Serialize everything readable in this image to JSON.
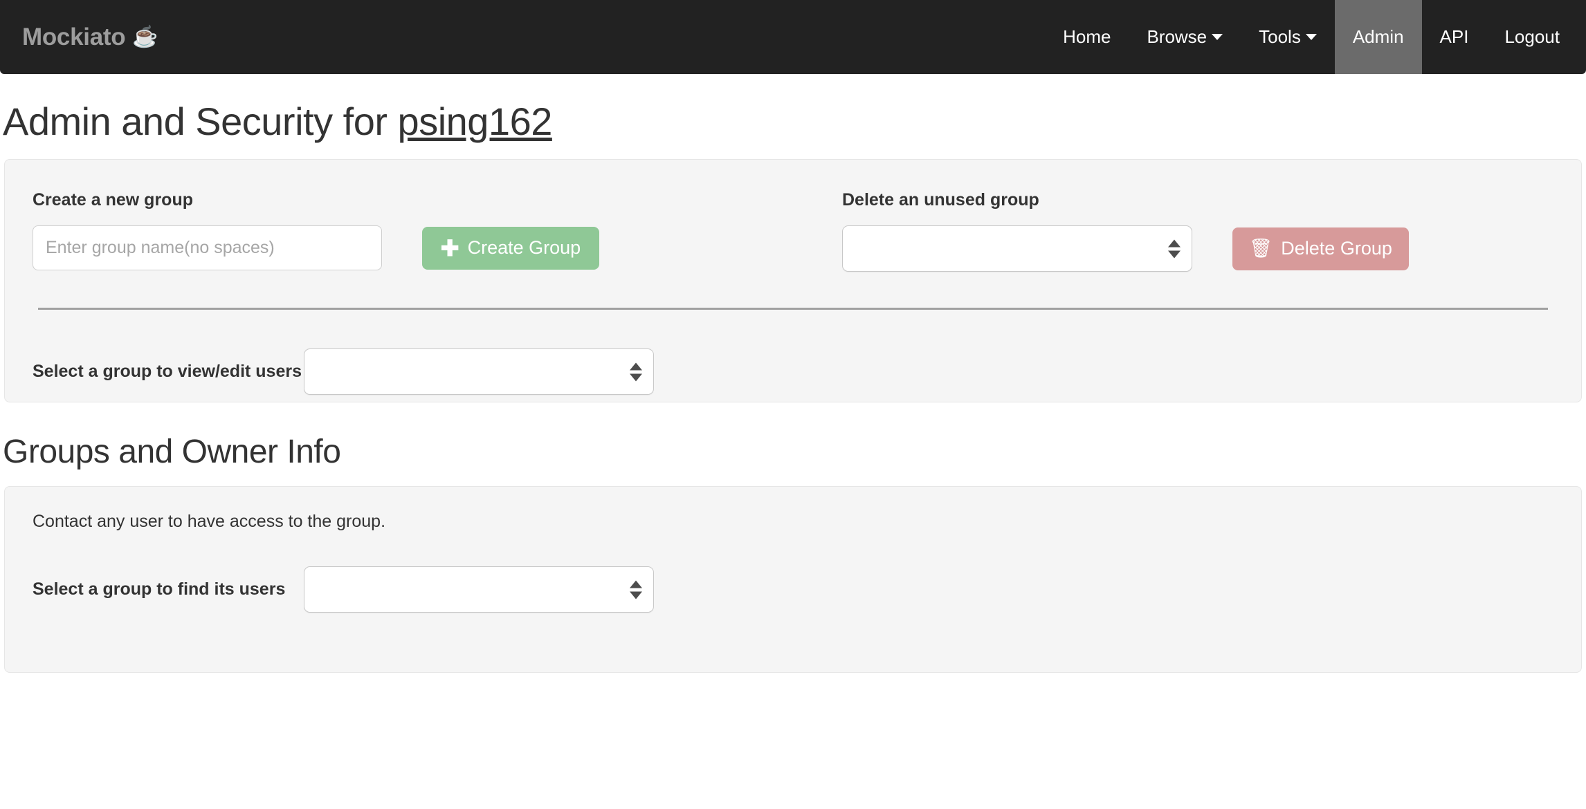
{
  "navbar": {
    "brand": "Mockiato",
    "brand_emoji": "☕",
    "links": [
      {
        "label": "Home",
        "has_caret": false,
        "active": false
      },
      {
        "label": "Browse",
        "has_caret": true,
        "active": false
      },
      {
        "label": "Tools",
        "has_caret": true,
        "active": false
      },
      {
        "label": "Admin",
        "has_caret": false,
        "active": true
      },
      {
        "label": "API",
        "has_caret": false,
        "active": false
      },
      {
        "label": "Logout",
        "has_caret": false,
        "active": false
      }
    ],
    "active_bg": "#6b6b6b",
    "bg": "#222222"
  },
  "page": {
    "title_prefix": "Admin and Security for ",
    "title_user": "psing162"
  },
  "admin_panel": {
    "create_heading": "Create a new group",
    "create_input_placeholder": "Enter group name(no spaces)",
    "create_input_value": "",
    "create_button_label": "Create Group",
    "create_button_color": "#8fc896",
    "delete_heading": "Delete an unused group",
    "delete_select_value": "",
    "delete_button_label": "Delete Group",
    "delete_button_color": "#d79a9a",
    "view_edit_label": "Select a group to view/edit users",
    "view_edit_select_value": ""
  },
  "groups_section": {
    "heading": "Groups and Owner Info",
    "note": "Contact any user to have access to the group.",
    "find_users_label": "Select a group to find its users",
    "find_users_select_value": ""
  }
}
